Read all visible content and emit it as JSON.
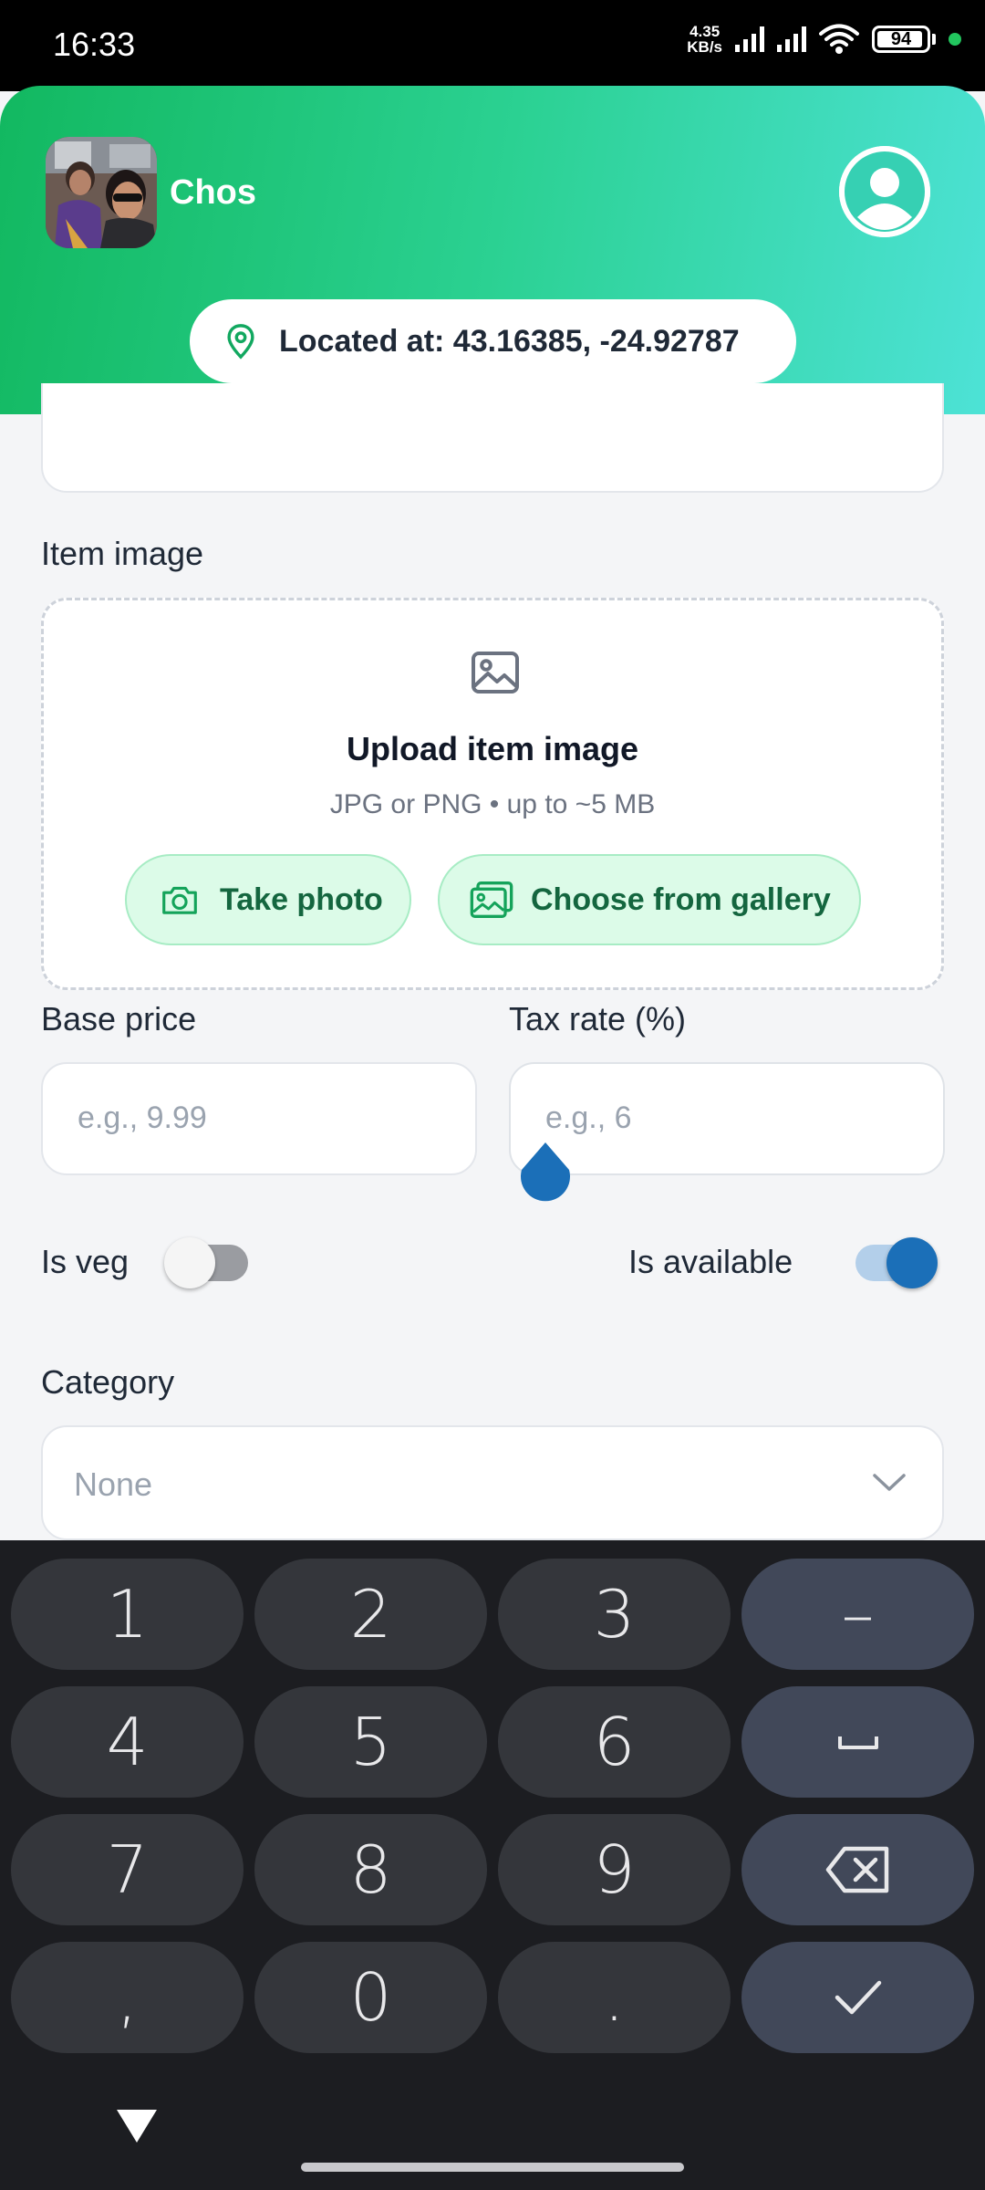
{
  "status_bar": {
    "time": "16:33",
    "net_speed_value": "4.35",
    "net_speed_unit": "KB/s",
    "battery": "94",
    "battery_level": 0.94
  },
  "header": {
    "user_name": "Chos",
    "location": "Located at: 43.16385, -24.92787",
    "gradient_start": "#12b860",
    "gradient_end": "#4de2d6"
  },
  "form": {
    "item_image": {
      "label": "Item image",
      "title": "Upload item image",
      "subtitle": "JPG or PNG • up to ~5 MB",
      "take_photo": "Take photo",
      "choose_gallery": "Choose from gallery"
    },
    "base_price": {
      "label": "Base price",
      "placeholder": "e.g., 9.99"
    },
    "tax_rate": {
      "label": "Tax rate (%)",
      "placeholder": "e.g., 6"
    },
    "is_veg": {
      "label": "Is veg",
      "checked": false
    },
    "is_available": {
      "label": "Is available",
      "checked": true
    },
    "category": {
      "label": "Category",
      "value": "None"
    }
  },
  "keyboard": {
    "keys": [
      "1",
      "2",
      "3",
      "–",
      "4",
      "5",
      "6",
      "␣",
      "7",
      "8",
      "9",
      "⌫",
      ",",
      "0",
      ".",
      "✓"
    ]
  },
  "colors": {
    "accent": "#1b6fb8",
    "button_bg": "#dcfbe8",
    "button_text": "#14663f"
  }
}
